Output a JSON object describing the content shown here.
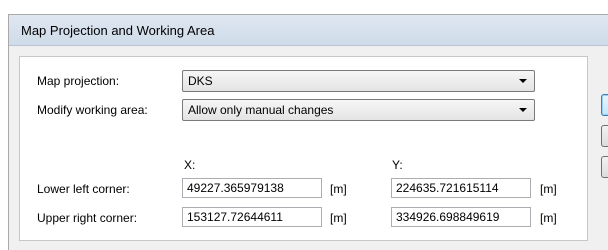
{
  "window": {
    "title": "Map Projection and Working Area"
  },
  "projection": {
    "label": "Map projection:",
    "selected": "DKS"
  },
  "working_area": {
    "label": "Modify working area:",
    "selected": "Allow only manual changes"
  },
  "coordinates": {
    "x_header": "X:",
    "y_header": "Y:",
    "unit": "[m]",
    "lower_left": {
      "label": "Lower left corner:",
      "x": "49227.365979138",
      "y": "224635.721615114"
    },
    "upper_right": {
      "label": "Upper right corner:",
      "x": "153127.72644611",
      "y": "334926.698849619"
    }
  }
}
